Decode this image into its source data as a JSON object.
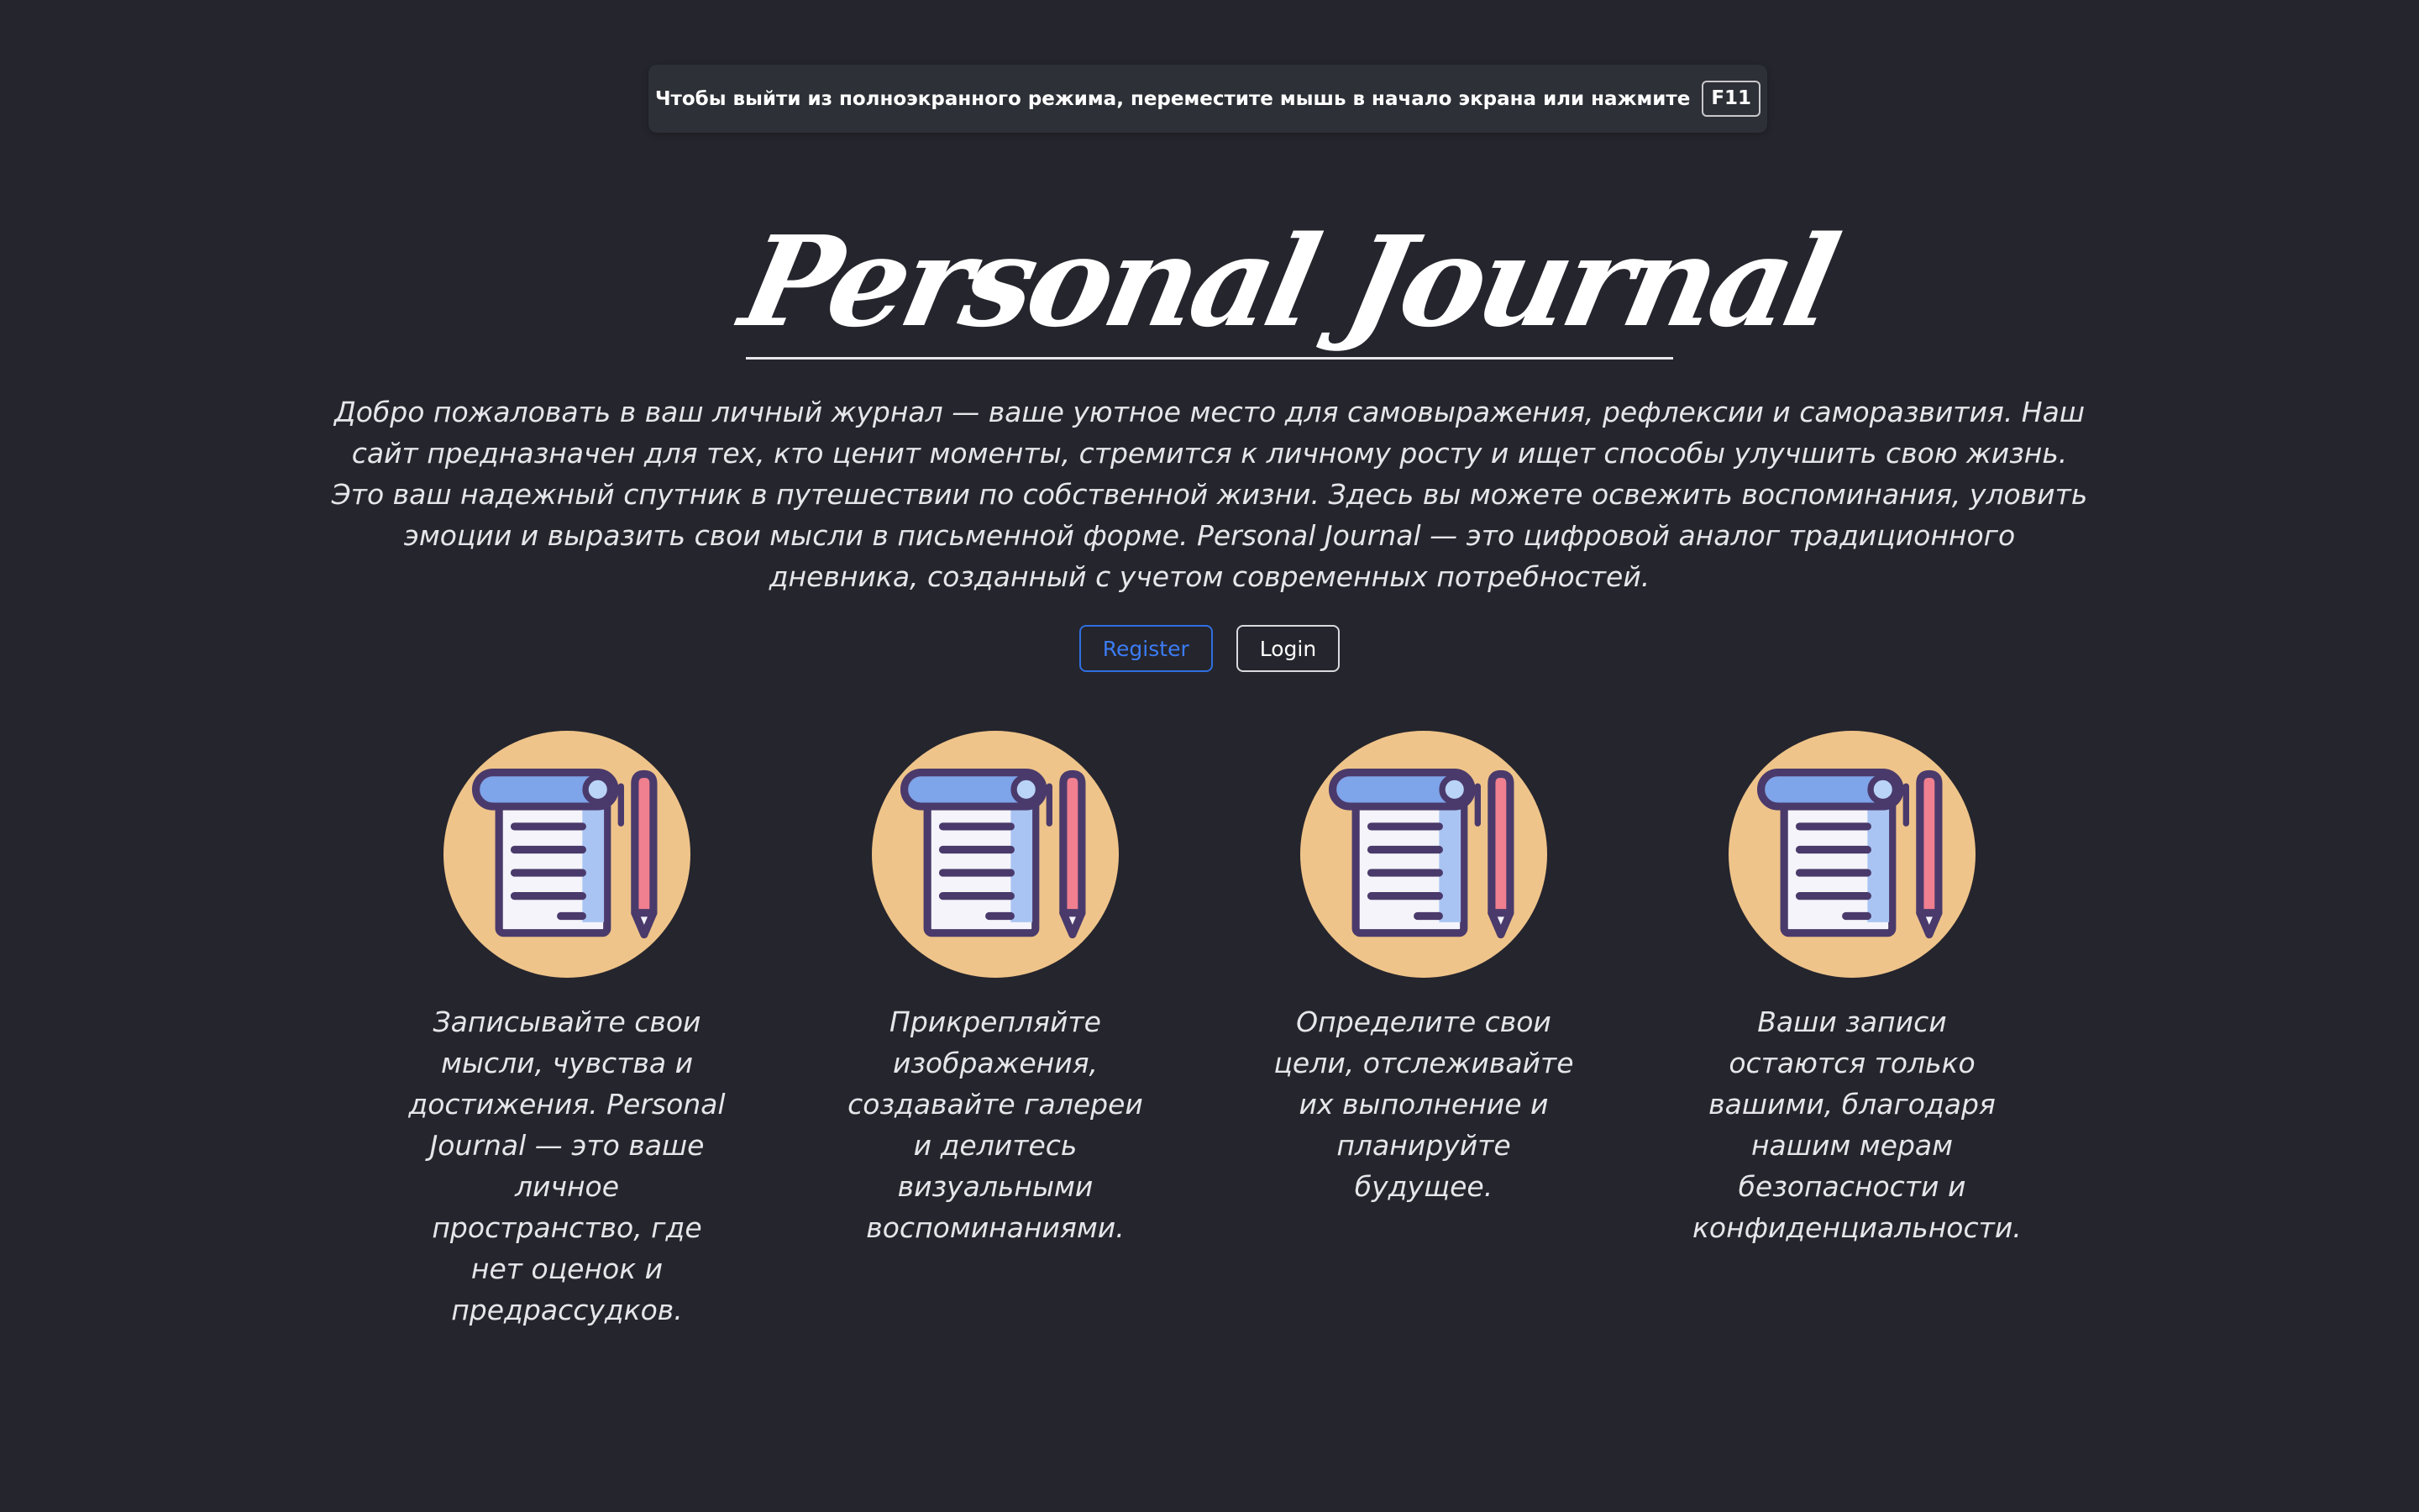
{
  "fullscreen_notice": {
    "message": "Чтобы выйти из полноэкранного режима, переместите мышь в начало экрана или нажмите",
    "key": "F11"
  },
  "hero": {
    "title": "Personal Journal",
    "intro_paragraphs": [
      "Добро пожаловать в ваш личный журнал — ваше уютное место для самовыражения, рефлексии и саморазвития. Наш сайт предназначен для тех, кто ценит моменты, стремится к личному росту и ищет способы улучшить свою жизнь.",
      "Это ваш надежный спутник в путешествии по собственной жизни. Здесь вы можете освежить воспоминания, уловить эмоции и выразить свои мысли в письменной форме. Personal Journal — это цифровой аналог традиционного дневника, созданный с учетом современных потребностей."
    ]
  },
  "auth": {
    "register_label": "Register",
    "login_label": "Login"
  },
  "features": [
    {
      "icon": "notepad-pen-icon",
      "text": "Записывайте свои мысли, чувства и достижения. Personal Journal — это ваше личное пространство, где нет оценок и предрассудков."
    },
    {
      "icon": "notepad-pen-icon",
      "text": "Прикрепляйте изображения, создавайте галереи и делитесь визуальными воспоминаниями."
    },
    {
      "icon": "notepad-pen-icon",
      "text": "Определите свои цели, отслеживайте их выполнение и планируйте будущее."
    },
    {
      "icon": "notepad-pen-icon",
      "text": "Ваши записи остаются только вашими, благодаря нашим мерам безопасности и конфиденциальности."
    }
  ],
  "colors": {
    "background": "#25252d",
    "icon_circle": "#efc48a",
    "register_accent": "#2f6fe0"
  }
}
